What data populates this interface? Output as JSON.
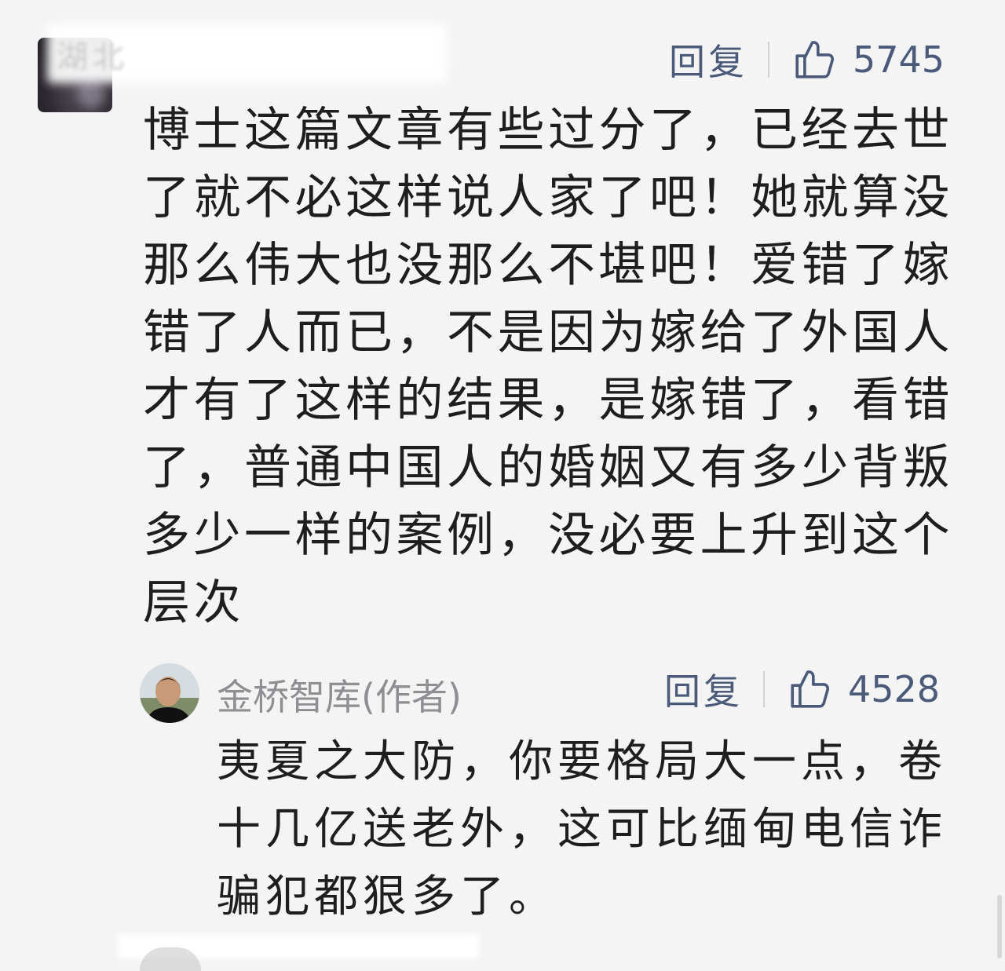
{
  "comment1": {
    "username": "湖北",
    "reply_label": "回复",
    "likes": "5745",
    "text": "博士这篇文章有些过分了，已经去世了就不必这样说人家了吧！她就算没那么伟大也没那么不堪吧！爱错了嫁错了人而已，不是因为嫁给了外国人才有了这样的结果，是嫁错了，看错了，普通中国人的婚姻又有多少背叛多少一样的案例，没必要上升到这个层次"
  },
  "comment2": {
    "author": "金桥智库(作者)",
    "reply_label": "回复",
    "likes": "4528",
    "text": "夷夏之大防，你要格局大一点，卷十几亿送老外，这可比缅甸电信诈骗犯都狠多了。"
  },
  "colors": {
    "background": "#f4f4f4",
    "action_text": "#4a5a78",
    "author_text": "#8e8e93",
    "body_text": "#1e1e1e"
  },
  "icons": [
    "thumbs-up-icon",
    "avatar"
  ]
}
